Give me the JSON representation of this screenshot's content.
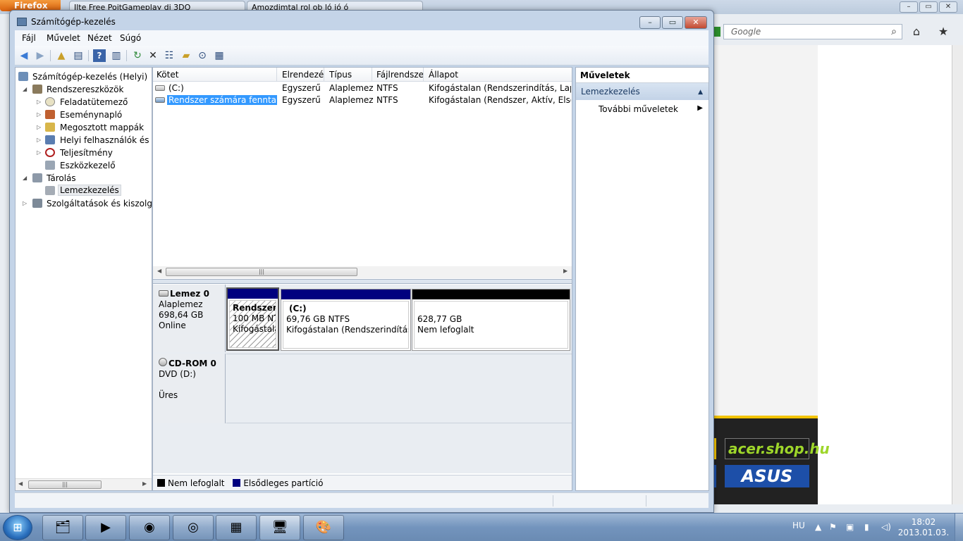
{
  "background_browser": {
    "menu_button": "Firefox",
    "tabs": [
      "Ilte Free PoitGameplay di 3DQ",
      "Amozdimtal rol ob ló ió ó"
    ],
    "search_placeholder": "Google"
  },
  "ads": {
    "acer": "acer.shop.hu",
    "asus": "ASUS"
  },
  "window": {
    "title": "Számítógép-kezelés",
    "controls": {
      "minimize": "–",
      "maximize": "▭",
      "close": "✕"
    }
  },
  "menu": [
    "Fájl",
    "Művelet",
    "Nézet",
    "Súgó"
  ],
  "toolbar_icons": [
    "back-arrow",
    "forward-arrow",
    "up-folder",
    "show-hide-tree",
    "help",
    "show-hide-action-pane",
    "refresh",
    "delete",
    "properties",
    "open",
    "find",
    "disk-settings"
  ],
  "tree": {
    "root": "Számítógép-kezelés (Helyi)",
    "items": [
      {
        "label": "Rendszereszközök",
        "level": 1,
        "expanded": true
      },
      {
        "label": "Feladatütemező",
        "level": 2,
        "expanded": false
      },
      {
        "label": "Eseménynapló",
        "level": 2,
        "expanded": false
      },
      {
        "label": "Megosztott mappák",
        "level": 2,
        "expanded": false
      },
      {
        "label": "Helyi felhasználók és cs",
        "level": 2,
        "expanded": false
      },
      {
        "label": "Teljesítmény",
        "level": 2,
        "expanded": false
      },
      {
        "label": "Eszközkezelő",
        "level": 2,
        "expanded": null
      },
      {
        "label": "Tárolás",
        "level": 1,
        "expanded": true
      },
      {
        "label": "Lemezkezelés",
        "level": 2,
        "selected": true
      },
      {
        "label": "Szolgáltatások és kiszolgáló",
        "level": 1,
        "expanded": false
      }
    ]
  },
  "volumes": {
    "columns": [
      "Kötet",
      "Elrendezés",
      "Típus",
      "Fájlrendszer",
      "Állapot"
    ],
    "rows": [
      {
        "kotet": "(C:)",
        "elrendezes": "Egyszerű",
        "tipus": "Alaplemez",
        "fajlrendszer": "NTFS",
        "allapot": "Kifogástalan (Rendszerindítás, Lapozóf"
      },
      {
        "kotet": "Rendszer számára fenntartott",
        "elrendezes": "Egyszerű",
        "tipus": "Alaplemez",
        "fajlrendszer": "NTFS",
        "allapot": "Kifogástalan (Rendszer, Aktív, Elsődleg",
        "selected": true
      }
    ]
  },
  "disks": [
    {
      "name": "Lemez 0",
      "type": "Alaplemez",
      "size": "698,64 GB",
      "status": "Online",
      "partitions": [
        {
          "title": "Rendszer s",
          "size": "100 MB NTFS",
          "status": "Kifogástalan",
          "kind": "primary",
          "selected": true
        },
        {
          "title": "(C:)",
          "size": "69,76 GB NTFS",
          "status": "Kifogástalan (Rendszerindítás, La",
          "kind": "primary"
        },
        {
          "title": "",
          "size": "628,77 GB",
          "status": "Nem lefoglalt",
          "kind": "unallocated"
        }
      ]
    },
    {
      "name": "CD-ROM 0",
      "type": "DVD (D:)",
      "size": "",
      "status": "Üres"
    }
  ],
  "legend": [
    {
      "label": "Nem lefoglalt",
      "color": "#000000"
    },
    {
      "label": "Elsődleges partíció",
      "color": "#00007f"
    }
  ],
  "actions": {
    "title": "Műveletek",
    "section": "Lemezkezelés",
    "item": "További műveletek"
  },
  "taskbar": {
    "apps": [
      "explorer",
      "media-player",
      "firefox",
      "media-center",
      "control-panel",
      "computer-management",
      "paint"
    ],
    "language": "HU",
    "time": "18:02",
    "date": "2013.01.03."
  },
  "colors": {
    "primary_partition": "#00007f",
    "unallocated": "#000000",
    "selection": "#3399ff"
  }
}
